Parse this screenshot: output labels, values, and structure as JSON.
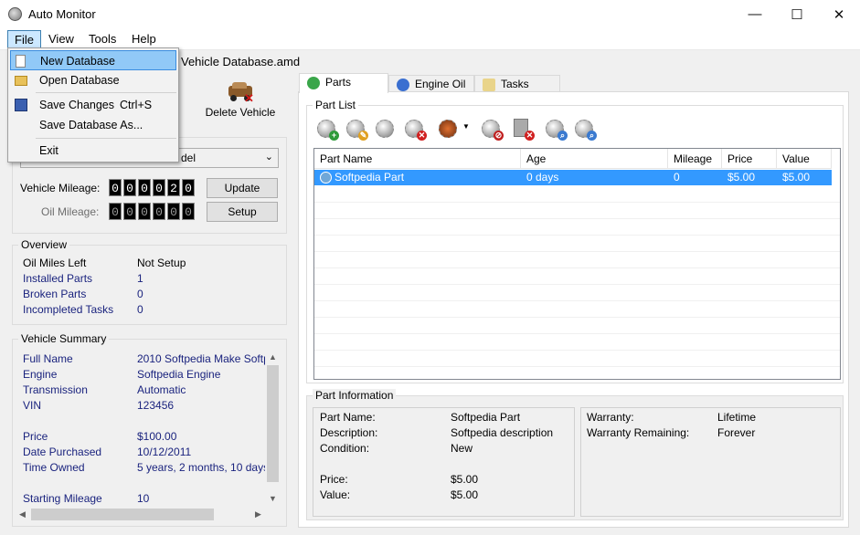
{
  "window": {
    "title": "Auto Monitor",
    "subtitle": "Vehicle Database.amd"
  },
  "menu": {
    "file": "File",
    "view": "View",
    "tools": "Tools",
    "help": "Help"
  },
  "file_menu": {
    "new_database": "New Database",
    "open_database": "Open Database",
    "save_changes": "Save Changes",
    "save_changes_shortcut": "Ctrl+S",
    "save_database_as": "Save Database As...",
    "exit": "Exit"
  },
  "toolbar": {
    "delete_vehicle": "Delete Vehicle"
  },
  "vehicle": {
    "select_value": "del",
    "mileage_label": "Vehicle Mileage:",
    "mileage_digits": [
      "0",
      "0",
      "0",
      "0",
      "2",
      "0"
    ],
    "oil_label": "Oil Mileage:",
    "oil_digits": [
      "0",
      "0",
      "0",
      "0",
      "0",
      "0"
    ],
    "update": "Update",
    "setup": "Setup"
  },
  "overview": {
    "title": "Overview",
    "rows": [
      {
        "key": "Oil Miles Left",
        "value": "Not Setup"
      },
      {
        "key": "Installed Parts",
        "value": "1"
      },
      {
        "key": "Broken Parts",
        "value": "0"
      },
      {
        "key": "Incompleted Tasks",
        "value": "0"
      }
    ]
  },
  "summary": {
    "title": "Vehicle Summary",
    "full_name_key": "Full Name",
    "full_name": "2010 Softpedia Make Softp...",
    "engine_key": "Engine",
    "engine": "Softpedia Engine",
    "transmission_key": "Transmission",
    "transmission": "Automatic",
    "vin_key": "VIN",
    "vin": "123456",
    "price_key": "Price",
    "price": "$100.00",
    "date_key": "Date Purchased",
    "date": "10/12/2011",
    "owned_key": "Time Owned",
    "owned": "5 years, 2 months, 10 days",
    "start_key": "Starting Mileage",
    "start": "10"
  },
  "tabs": {
    "parts": "Parts",
    "engine_oil": "Engine Oil",
    "tasks": "Tasks"
  },
  "part_list": {
    "title": "Part List",
    "columns": [
      "Part Name",
      "Age",
      "Mileage",
      "Price",
      "Value"
    ],
    "rows": [
      {
        "name": "Softpedia Part",
        "age": "0 days",
        "mileage": "0",
        "price": "$5.00",
        "value": "$5.00"
      }
    ]
  },
  "part_info": {
    "title": "Part Information",
    "name_key": "Part Name:",
    "name": "Softpedia Part",
    "desc_key": "Description:",
    "desc": "Softpedia description",
    "cond_key": "Condition:",
    "cond": "New",
    "price_key": "Price:",
    "price": "$5.00",
    "value_key": "Value:",
    "value": "$5.00",
    "warranty_key": "Warranty:",
    "warranty": "Lifetime",
    "warranty_rem_key": "Warranty Remaining:",
    "warranty_rem": "Forever"
  },
  "colors": {
    "selection": "#3399ff",
    "menu_highlight": "#91c9f7",
    "link_text": "#1a237e"
  }
}
